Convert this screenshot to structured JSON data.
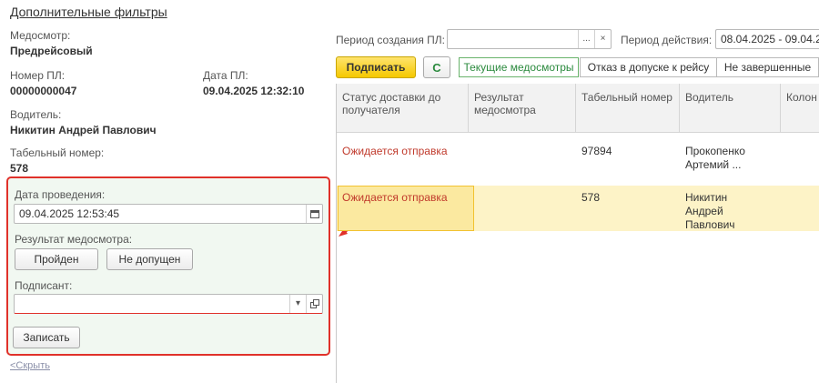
{
  "left": {
    "title_link": "Дополнительные фильтры",
    "medosmotr_label": "Медосмотр:",
    "medosmotr_value": "Предрейсовый",
    "nomer_label": "Номер ПЛ:",
    "nomer_value": "00000000047",
    "data_label": "Дата ПЛ:",
    "data_value": "09.04.2025 12:32:10",
    "driver_label": "Водитель:",
    "driver_value": "Никитин Андрей Павлович",
    "tab_label": "Табельный номер:",
    "tab_value": "578",
    "hide_link": "<Скрыть"
  },
  "form": {
    "date_label": "Дата проведения:",
    "date_value": "09.04.2025 12:53:45",
    "result_label": "Результат медосмотра:",
    "passed_button": "Пройден",
    "not_admitted_button": "Не допущен",
    "signer_label": "Подписант:",
    "signer_value": "",
    "save_button": "Записать"
  },
  "toolbar": {
    "period_label": "Период создания ПЛ:",
    "period_value": "",
    "period_dots": "...",
    "period_clear": "×",
    "action_label": "Период действия:",
    "action_value": "08.04.2025 - 09.04.20",
    "sign_button": "Подписать",
    "refresh_icon": "C",
    "tabs": [
      "Текущие медосмотры",
      "Отказ в допуске к рейсу",
      "Не завершенные"
    ]
  },
  "table": {
    "headers": [
      "Статус доставки до получателя",
      "Результат медосмотра",
      "Табельный номер",
      "Водитель",
      "Колон"
    ],
    "rows": [
      {
        "status": "Ожидается отправка",
        "result": "",
        "tab": "97894",
        "driver": "Прокопенко Артемий ..."
      },
      {
        "status": "Ожидается отправка",
        "result": "",
        "tab": "578",
        "driver": "Никитин Андрей Павлович"
      }
    ]
  },
  "colors": {
    "highlight_border": "#e0312a",
    "sign_button": "#f5c800",
    "status_text": "#c0392b",
    "active_tab": "#2b8a3e"
  }
}
